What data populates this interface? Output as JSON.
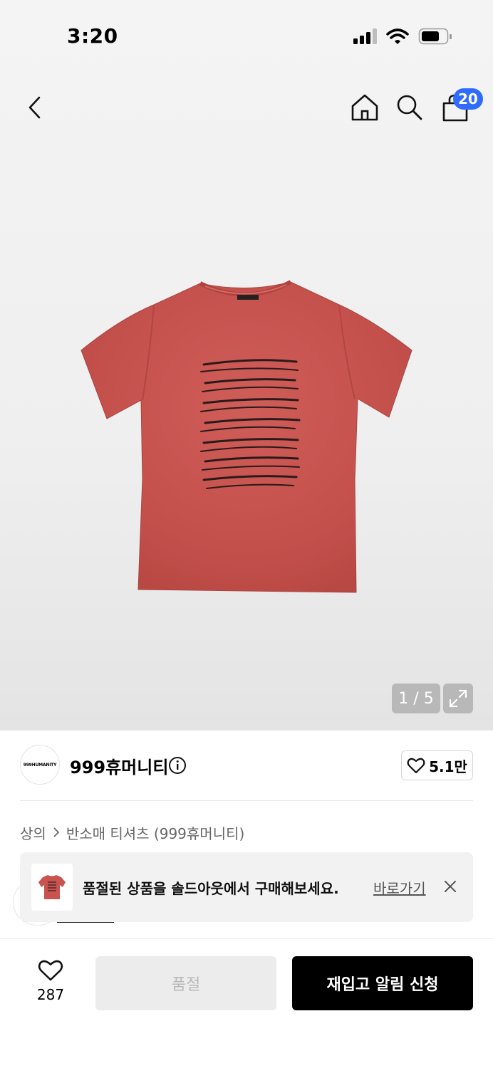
{
  "status_bar": {
    "time": "3:20"
  },
  "nav": {
    "cart_count": "20"
  },
  "gallery": {
    "counter": "1 / 5"
  },
  "brand": {
    "logo_text": "999HUMANITY",
    "name": "999휴머니티",
    "likes": "5.1만"
  },
  "breadcrumb": {
    "items": [
      "상의",
      "반소매 티셔츠 (999휴머니티)"
    ]
  },
  "banner": {
    "message": "품절된 상품을 솔드아웃에서 구매해보세요.",
    "link": "바로가기"
  },
  "bottom": {
    "wish_count": "287",
    "soldout_label": "품절",
    "restock_label": "재입고 알림 신청"
  },
  "colors": {
    "accent_blue": "#2f6bff",
    "shirt": "#c9534f",
    "primary_button": "#000000"
  }
}
